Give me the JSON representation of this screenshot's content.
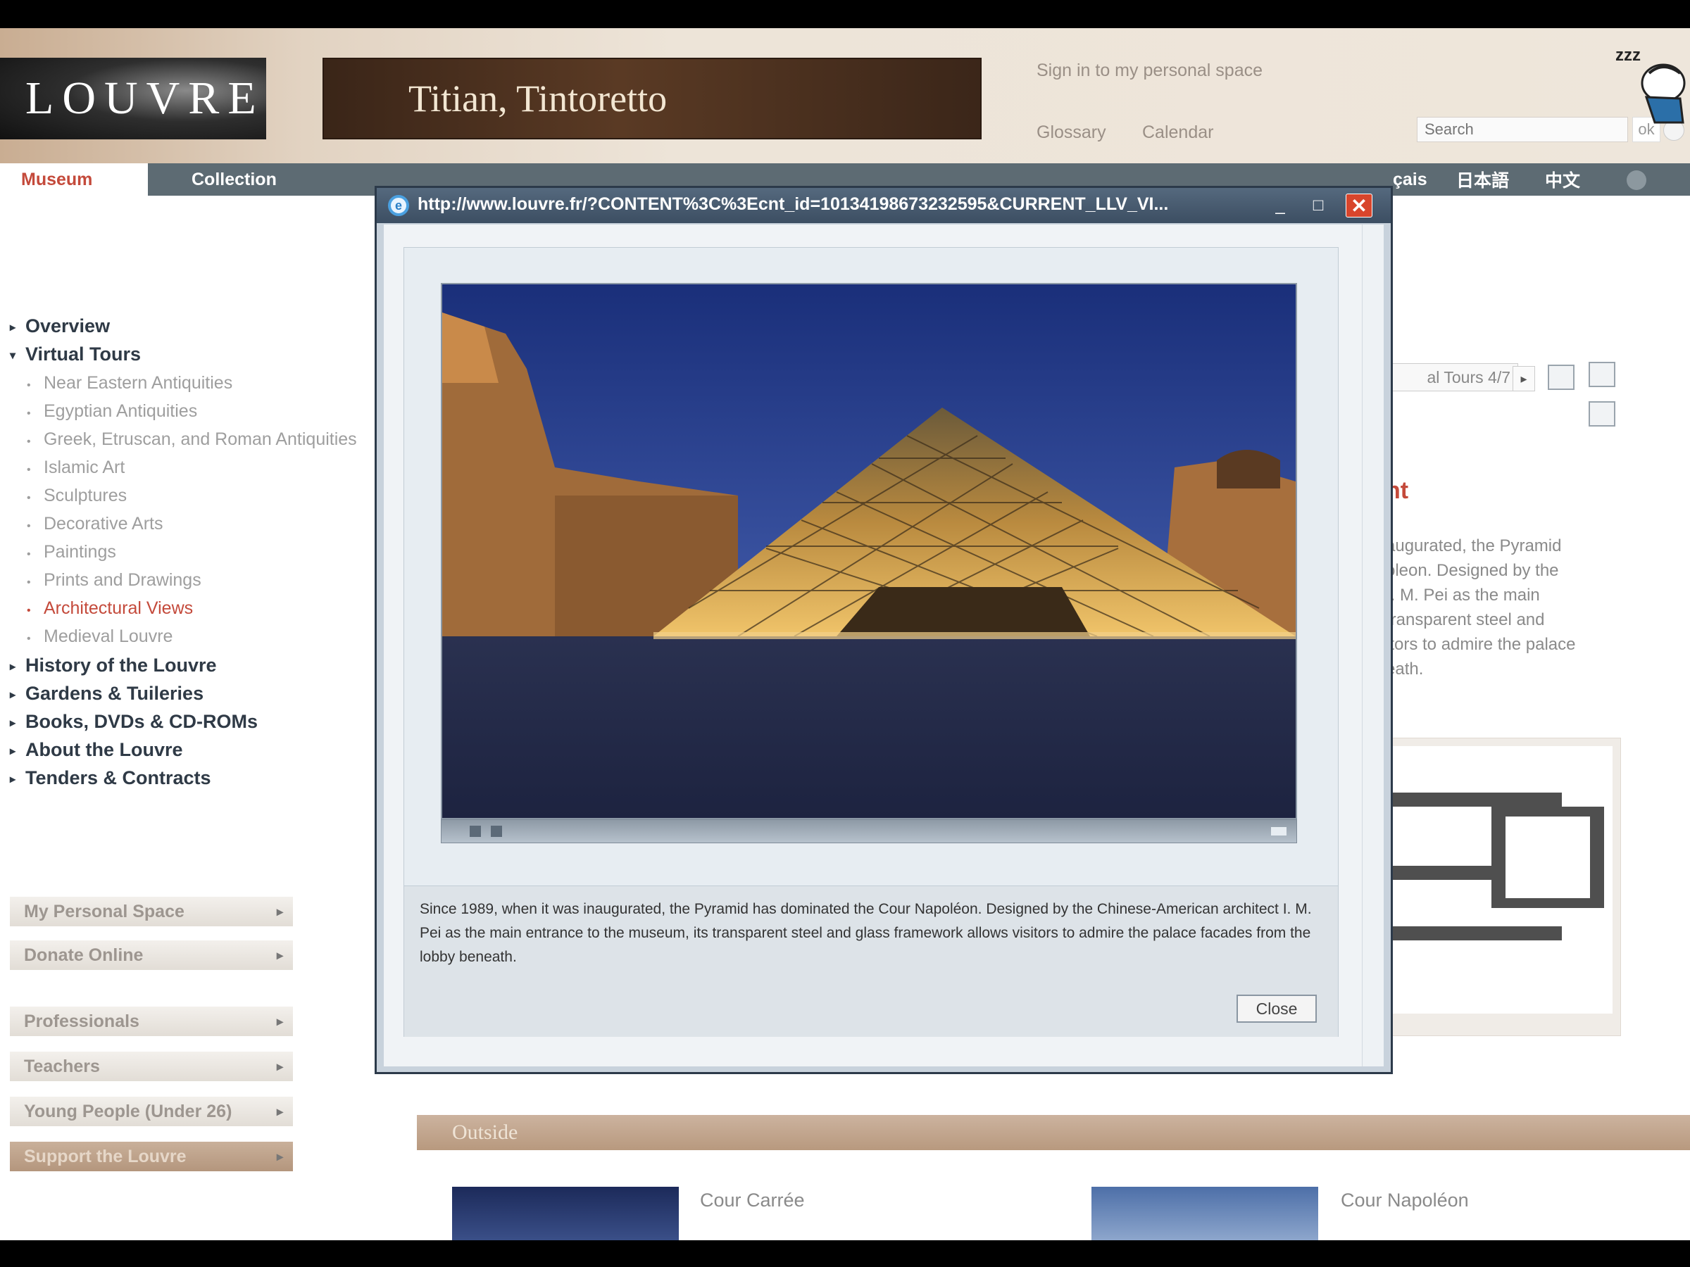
{
  "header": {
    "logo_text": "LOUVRE",
    "banner_text": "Titian, Tintoretto",
    "signin_link": "Sign in to my personal space",
    "glossary_link": "Glossary",
    "calendar_link": "Calendar",
    "search_placeholder": "Search",
    "search_ok": "ok"
  },
  "nav": {
    "museum": "Museum",
    "collection": "Collection",
    "lang_fr_fragment": "çais",
    "lang_ja": "日本語",
    "lang_zh": "中文"
  },
  "sidebar": {
    "main_items": [
      "Overview",
      "Virtual Tours",
      "History of the Louvre",
      "Gardens & Tuileries",
      "Books, DVDs & CD-ROMs",
      "About the Louvre",
      "Tenders & Contracts"
    ],
    "sub_items": [
      "Near Eastern Antiquities",
      "Egyptian Antiquities",
      "Greek, Etruscan, and Roman Antiquities",
      "Islamic Art",
      "Sculptures",
      "Decorative Arts",
      "Paintings",
      "Prints and Drawings",
      "Architectural Views",
      "Medieval Louvre"
    ],
    "active_sub": "Architectural Views",
    "buttons": [
      "My Personal Space",
      "Donate Online",
      "Professionals",
      "Teachers",
      "Young People (Under 26)",
      "Support the Louvre"
    ]
  },
  "right": {
    "tours_fragment": "al Tours 4/7",
    "heading_fragment": "ht",
    "para_lines": [
      "augurated, the Pyramid",
      "oleon. Designed by the",
      "I. M. Pei as the main",
      "transparent steel and",
      "itors to admire the palace",
      "eath."
    ]
  },
  "outside": {
    "title": "Outside",
    "item1": "Cour Carrée",
    "item2": "Cour Napoléon"
  },
  "popup": {
    "url": "http://www.louvre.fr/?CONTENT%3C%3Ecnt_id=10134198673232595&CURRENT_LLV_VI...",
    "caption": "Since 1989, when it was inaugurated, the Pyramid has dominated the Cour Napoléon. Designed by the Chinese-American architect I. M. Pei as the main entrance to the museum, its transparent steel and glass framework allows visitors to admire the palace facades from the lobby beneath.",
    "close_label": "Close"
  },
  "colors": {
    "accent_red": "#c44a3b",
    "nav_slate": "#5d6b73",
    "tan": "#b8997e"
  }
}
